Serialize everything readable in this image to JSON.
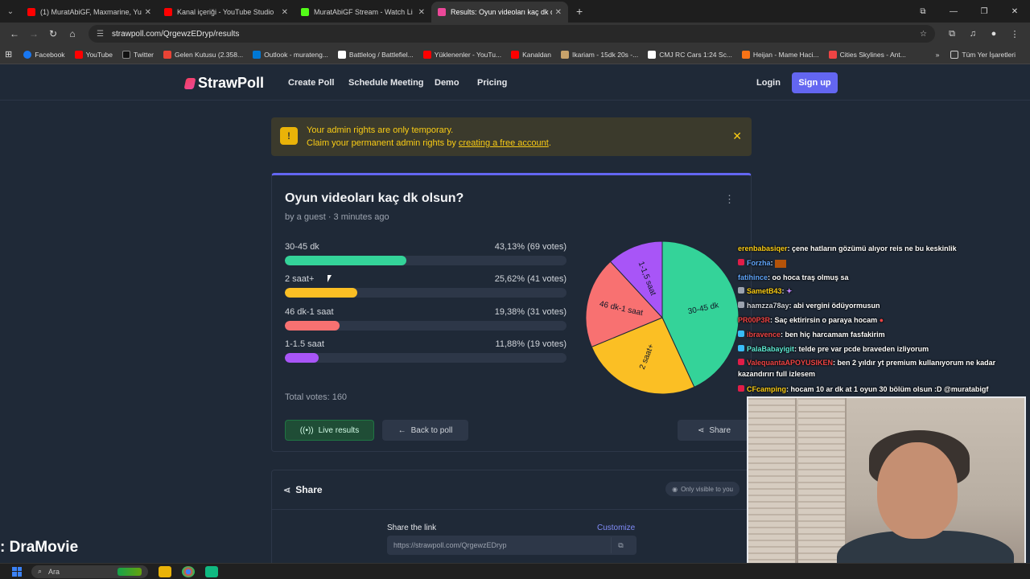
{
  "browser": {
    "tabs": [
      {
        "title": "(1) MuratAbiGF, Maxmarine, Yu",
        "color": "#ff0000",
        "active": false
      },
      {
        "title": "Kanal içeriği - YouTube Studio",
        "color": "#ff0000",
        "active": false
      },
      {
        "title": "MuratAbiGF Stream - Watch Li",
        "color": "#53fc18",
        "active": false
      },
      {
        "title": "Results: Oyun videoları kaç dk o",
        "color": "#ec4899",
        "active": true
      }
    ],
    "url": "strawpoll.com/QrgewzEDryp/results",
    "bookmarks": [
      {
        "label": "Facebook",
        "color": "#1877f2"
      },
      {
        "label": "YouTube",
        "color": "#ff0000"
      },
      {
        "label": "Twitter",
        "color": "#111111"
      },
      {
        "label": "Gelen Kutusu (2.358...",
        "color": "#ea4335"
      },
      {
        "label": "Outlook - murateng...",
        "color": "#0078d4"
      },
      {
        "label": "Battlelog / Battlefiel...",
        "color": "#ffffff"
      },
      {
        "label": "Yüklenenler - YouTu...",
        "color": "#ff0000"
      },
      {
        "label": "Kanaldan",
        "color": "#ff0000"
      },
      {
        "label": "Ikariam - 15dk 20s -...",
        "color": "#c8a26a"
      },
      {
        "label": "CMJ RC Cars 1:24 Sc...",
        "color": "#ffffff"
      },
      {
        "label": "Heijan - Mame Haci...",
        "color": "#f97316"
      },
      {
        "label": "Cities Skylines - Ant...",
        "color": "#ef4444"
      }
    ],
    "all_bookmarks": "Tüm Yer İşaretleri"
  },
  "site": {
    "brand": "StrawPoll",
    "nav": [
      "Create Poll",
      "Schedule Meeting",
      "Demo",
      "Pricing"
    ],
    "login": "Login",
    "signup": "Sign up"
  },
  "alert": {
    "line1": "Your admin rights are only temporary.",
    "line2_prefix": "Claim your permanent admin rights by ",
    "line2_link": "creating a free account",
    "line2_suffix": "."
  },
  "poll": {
    "title": "Oyun videoları kaç dk olsun?",
    "meta": "by a guest · 3 minutes ago",
    "total": "Total votes: 160",
    "buttons": {
      "live": "Live results",
      "back": "Back to poll",
      "share": "Share"
    }
  },
  "chart_data": {
    "type": "bar",
    "categories": [
      "30-45 dk",
      "2 saat+",
      "46 dk-1 saat",
      "1-1.5 saat"
    ],
    "percent_labels": [
      "43,13% (69 votes)",
      "25,62% (41 votes)",
      "19,38% (31 votes)",
      "11,88% (19 votes)"
    ],
    "values": [
      43.13,
      25.62,
      19.38,
      11.88
    ],
    "votes": [
      69,
      41,
      31,
      19
    ],
    "colors": [
      "#34d399",
      "#fbbf24",
      "#f87171",
      "#a855f7"
    ],
    "pie_labels": [
      "30-45 dk",
      "2 saat+",
      "46 dk-1 saat",
      "1-1,5 saat"
    ]
  },
  "share": {
    "title": "Share",
    "visibility": "Only visible to you",
    "link_label": "Share the link",
    "customize": "Customize",
    "link": "https://strawpoll.com/QrgewzEDryp"
  },
  "chat": [
    {
      "user": "erenbabasiqer",
      "color": "#facc15",
      "text": ": çene hatların gözümü alıyor reis ne bu keskinlik"
    },
    {
      "user": "Forzha",
      "color": "#60a5fa",
      "text": ": "
    },
    {
      "user": "fatihince",
      "color": "#60a5fa",
      "text": ": oo hoca traş olmuş sa"
    },
    {
      "user": "SametB43",
      "color": "#facc15",
      "text": ": "
    },
    {
      "user": "hamzza78ay",
      "color": "#d1d5db",
      "text": ": abi vergini ödüyormusun"
    },
    {
      "user": "PR00P3R",
      "color": "#ef4444",
      "text": ": Saç ektirirsin o paraya hocam"
    },
    {
      "user": "ibravence",
      "color": "#ef4444",
      "text": ": ben hiç harcamam fasfakirim"
    },
    {
      "user": "PalaBabayigit",
      "color": "#5eead4",
      "text": ": telde pre var pcde braveden izliyorum"
    },
    {
      "user": "ValequantaAPOYUSIKEN",
      "color": "#ef4444",
      "text": ": ben 2 yıldır yt premium kullanıyorum ne kadar kazandırırı full izlesem"
    },
    {
      "user": "CFcamping",
      "color": "#facc15",
      "text": ": hocam 10 ar dk at 1 oyun 30 bölüm olsun :D @muratabigf"
    }
  ],
  "overlay_text": ": DraMovie",
  "taskbar": {
    "search": "Ara"
  }
}
